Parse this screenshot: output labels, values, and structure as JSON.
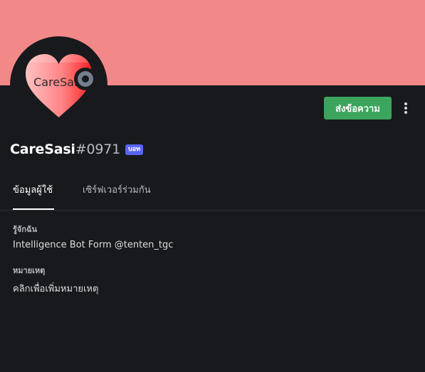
{
  "colors": {
    "banner": "#f38889",
    "background": "#18191c",
    "send_button": "#3ba55d",
    "bot_badge": "#5865f2",
    "status": "#747f8d"
  },
  "avatar": {
    "text": "CareSasi"
  },
  "status": {
    "icon": "offline-status-icon"
  },
  "actions": {
    "send_message_label": "ส่งข้อความ",
    "more_icon": "more-options-icon"
  },
  "profile": {
    "username": "CareSasi",
    "discriminator": "#0971",
    "badge": "บอท"
  },
  "tabs": [
    {
      "label": "ข้อมูลผู้ใช้",
      "active": true
    },
    {
      "label": "เซิร์ฟเวอร์ร่วมกัน",
      "active": false
    }
  ],
  "sections": {
    "about": {
      "heading": "รู้จักฉัน",
      "text": "Intelligence Bot Form @tenten_tgc"
    },
    "note": {
      "heading": "หมายเหตุ",
      "text": "คลิกเพื่อเพิ่มหมายเหตุ"
    }
  }
}
